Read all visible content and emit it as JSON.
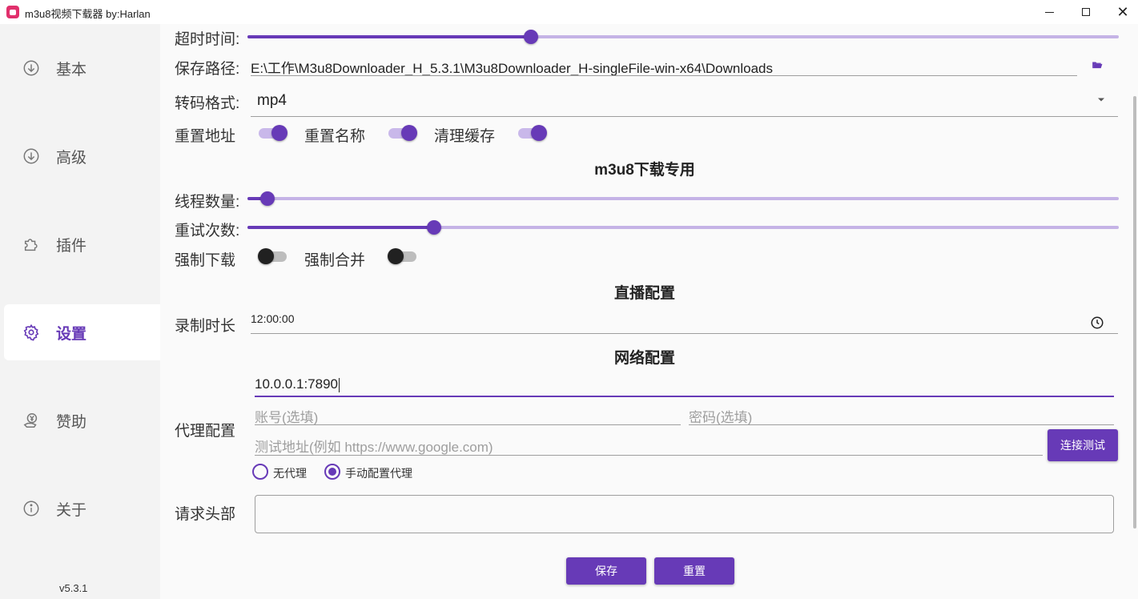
{
  "window": {
    "title": "m3u8视频下载器 by:Harlan",
    "close_glyph": "✕"
  },
  "sidebar": {
    "items": [
      {
        "label": "基本",
        "icon": "download-circle-icon"
      },
      {
        "label": "高级",
        "icon": "download-circle-icon"
      },
      {
        "label": "插件",
        "icon": "puzzle-icon"
      },
      {
        "label": "设置",
        "icon": "gear-icon",
        "active": true
      },
      {
        "label": "赞助",
        "icon": "yen-hand-icon"
      },
      {
        "label": "关于",
        "icon": "info-icon"
      }
    ],
    "version": "v5.3.1"
  },
  "settings": {
    "timeout": {
      "label": "超时时间:",
      "value_fraction": 0.325
    },
    "save_path": {
      "label": "保存路径:",
      "value": "E:\\工作\\M3u8Downloader_H_5.3.1\\M3u8Downloader_H-singleFile-win-x64\\Downloads"
    },
    "transcode": {
      "label": "转码格式:",
      "value": "mp4"
    },
    "toggles_row1": [
      {
        "label": "重置地址",
        "on": true
      },
      {
        "label": "重置名称",
        "on": true
      },
      {
        "label": "清理缓存",
        "on": true
      }
    ]
  },
  "m3u8_section": {
    "title": "m3u8下载专用",
    "threads": {
      "label": "线程数量:",
      "value_fraction": 0.023
    },
    "retries": {
      "label": "重试次数:",
      "value_fraction": 0.214
    },
    "toggles": [
      {
        "label": "强制下载",
        "on": false
      },
      {
        "label": "强制合并",
        "on": false
      }
    ]
  },
  "live_section": {
    "title": "直播配置",
    "record_duration": {
      "label": "录制时长",
      "value": "12:00:00"
    }
  },
  "network_section": {
    "title": "网络配置",
    "proxy_label": "代理配置",
    "proxy_address": "10.0.0.1:7890",
    "account_placeholder": "账号(选填)",
    "password_placeholder": "密码(选填)",
    "test_url_placeholder": "测试地址(例如 https://www.google.com)",
    "test_button": "连接测试",
    "radio_options": [
      {
        "label": "无代理",
        "checked": false
      },
      {
        "label": "手动配置代理",
        "checked": true
      }
    ],
    "headers_label": "请求头部",
    "headers_value": ""
  },
  "actions": {
    "save": "保存",
    "reset": "重置"
  },
  "colors": {
    "accent": "#673ab7",
    "accent_light": "#c5b3e6"
  }
}
